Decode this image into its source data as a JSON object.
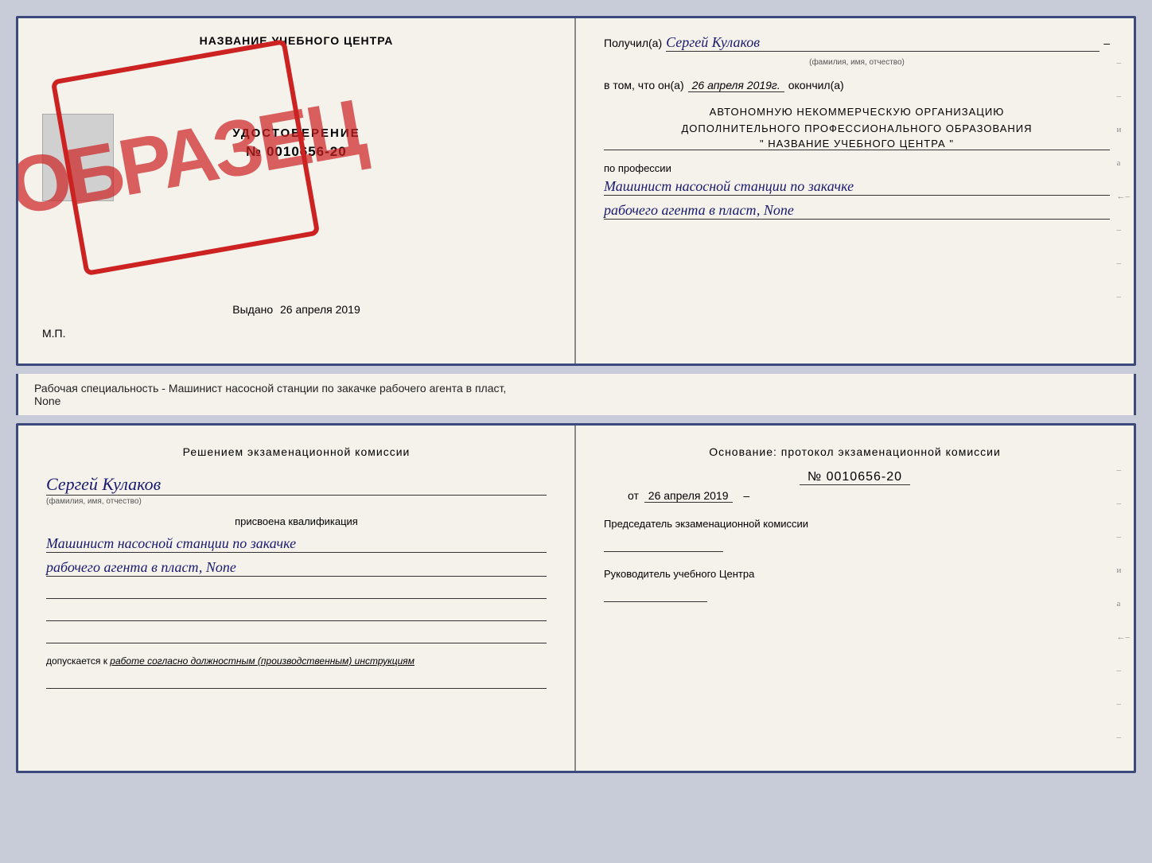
{
  "document": {
    "top": {
      "left": {
        "center_title": "НАЗВАНИЕ УЧЕБНОГО ЦЕНТРА",
        "photo_alt": "фото",
        "udostoverenie_title": "УДОСТОВЕРЕНИЕ",
        "udostoverenie_number": "№ 0010656-20",
        "vydano_label": "Выдано",
        "vydano_date": "26 апреля 2019",
        "mp_label": "М.П.",
        "stamp_text": "ОБРАЗЕЦ"
      },
      "right": {
        "recipient_label": "Получил(а)",
        "recipient_name": "Сергей Кулаков",
        "fio_hint": "(фамилия, имя, отчество)",
        "date_label": "в том, что он(а)",
        "date_value": "26 апреля 2019г.",
        "okончил_label": "окончил(а)",
        "org_line1": "АВТОНОМНУЮ НЕКОММЕРЧЕСКУЮ ОРГАНИЗАЦИЮ",
        "org_line2": "ДОПОЛНИТЕЛЬНОГО ПРОФЕССИОНАЛЬНОГО ОБРАЗОВАНИЯ",
        "org_name": "\" НАЗВАНИЕ УЧЕБНОГО ЦЕНТРА \"",
        "profession_label": "по профессии",
        "profession_line1": "Машинист насосной станции по закачке",
        "profession_line2": "рабочего агента в пласт, None"
      }
    },
    "separator": {
      "text": "Рабочая специальность - Машинист насосной станции по закачке рабочего агента в пласт,",
      "text2": "None"
    },
    "bottom": {
      "left": {
        "commission_title": "Решением экзаменационной комиссии",
        "person_name": "Сергей Кулаков",
        "fio_hint": "(фамилия, имя, отчество)",
        "qualification_label": "присвоена квалификация",
        "qualification_line1": "Машинист насосной станции по закачке",
        "qualification_line2": "рабочего агента в пласт, None",
        "допускается_label": "допускается к",
        "допускается_value": "работе согласно должностным (производственным) инструкциям"
      },
      "right": {
        "osnование_title": "Основание: протокол экзаменационной комиссии",
        "protocol_number": "№ 0010656-20",
        "date_prefix": "от",
        "date_value": "26 апреля 2019",
        "chairman_label": "Председатель экзаменационной комиссии",
        "руководитель_label": "Руководитель учебного Центра"
      }
    }
  }
}
